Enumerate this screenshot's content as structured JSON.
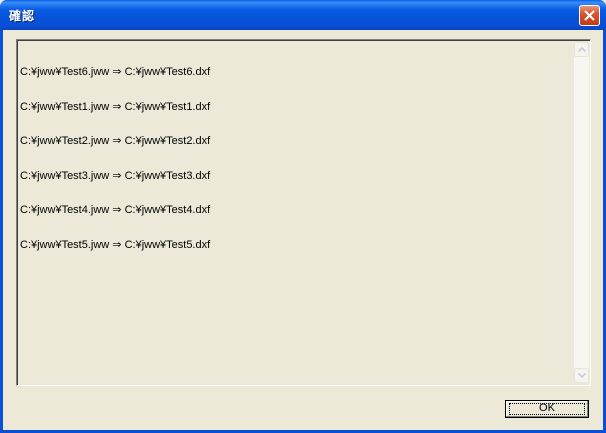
{
  "window": {
    "title": "確認",
    "colors": {
      "titlebar": "#0a4fd6",
      "client": "#ece9d8",
      "close_button": "#d8542e"
    }
  },
  "list": {
    "items": [
      "C:¥jww¥Test6.jww ⇒ C:¥jww¥Test6.dxf",
      "C:¥jww¥Test1.jww ⇒ C:¥jww¥Test1.dxf",
      "C:¥jww¥Test2.jww ⇒ C:¥jww¥Test2.dxf",
      "C:¥jww¥Test3.jww ⇒ C:¥jww¥Test3.dxf",
      "C:¥jww¥Test4.jww ⇒ C:¥jww¥Test4.dxf",
      "C:¥jww¥Test5.jww ⇒ C:¥jww¥Test5.dxf"
    ]
  },
  "buttons": {
    "ok_label": "OK"
  },
  "icons": {
    "close": "close-icon",
    "scroll_up": "chevron-up-icon",
    "scroll_down": "chevron-down-icon"
  }
}
